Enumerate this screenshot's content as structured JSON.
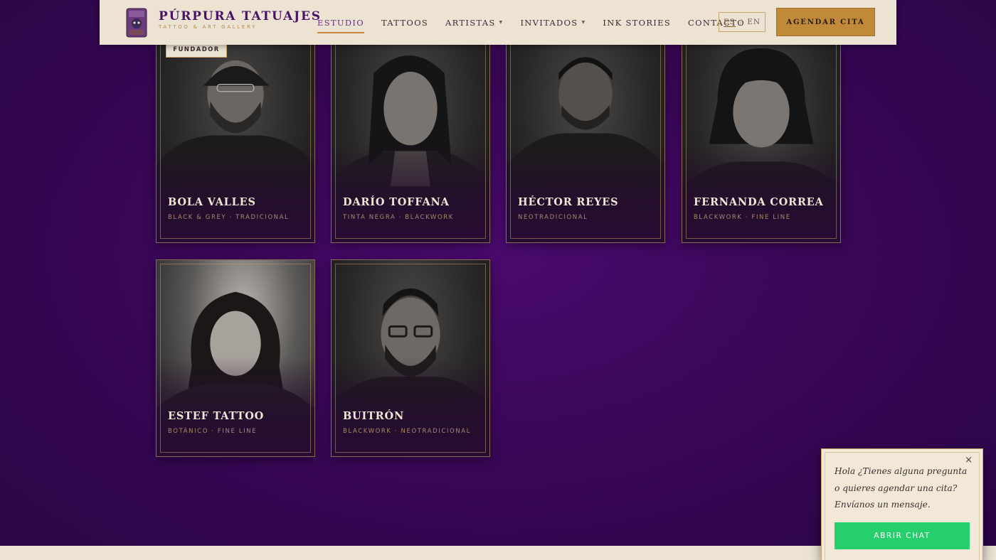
{
  "header": {
    "brand_name": "PÚRPURA TATUAJES",
    "brand_sub": "TATTOO & ART GALLERY",
    "nav": [
      {
        "label": "ESTUDIO",
        "active": true
      },
      {
        "label": "TATTOOS"
      },
      {
        "label": "ARTISTAS",
        "dropdown": true
      },
      {
        "label": "INVITADOS",
        "dropdown": true
      },
      {
        "label": "INK STORIES"
      },
      {
        "label": "CONTACTO"
      }
    ],
    "caret": "▼",
    "lang_es": "ES",
    "lang_sep": "/",
    "lang_en": "EN",
    "cta": "AGENDAR CITA"
  },
  "artists": [
    {
      "name": "BOLA VALLES",
      "style": "BLACK & GREY · TRADICIONAL",
      "badge": "FUNDADOR"
    },
    {
      "name": "DARÍO TOFFANA",
      "style": "TINTA NEGRA · BLACKWORK"
    },
    {
      "name": "HÉCTOR REYES",
      "style": "NEOTRADICIONAL"
    },
    {
      "name": "FERNANDA CORREA",
      "style": "BLACKWORK · FINE LINE"
    },
    {
      "name": "ESTEF TATTOO",
      "style": "BOTÁNICO · FINE LINE"
    },
    {
      "name": "BUITRÓN",
      "style": "BLACKWORK · NEOTRADICIONAL"
    }
  ],
  "chat": {
    "close": "×",
    "message": "Hola  ¿Tienes alguna pregunta o quieres agendar una cita? Envíanos un mensaje.",
    "button": "ABRIR CHAT"
  },
  "colors": {
    "accent": "#c08a3a",
    "brand": "#4a1466",
    "chat_button": "#25cf6b"
  }
}
